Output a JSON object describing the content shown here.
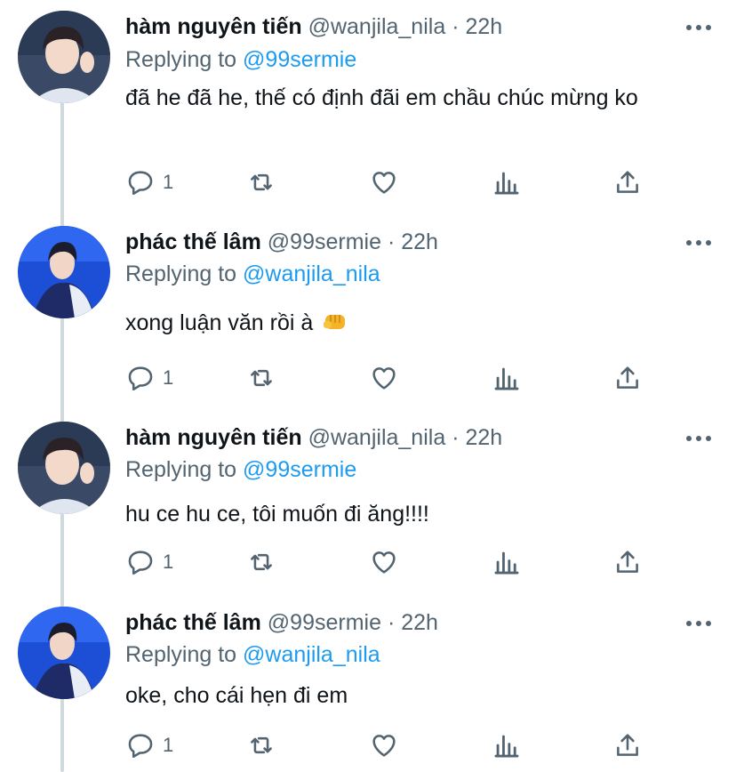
{
  "tweets": [
    {
      "name": "hàm nguyên tiến",
      "handle": "@wanjila_nila",
      "separator": "·",
      "time": "22h",
      "replying_label": "Replying to",
      "replying_to": "@99sermie",
      "text": "đã he đã he, thế có định đãi em chầu chúc mừng ko",
      "reply_count": "1",
      "avatar_icon": "avatar-boy-white-shirt"
    },
    {
      "name": "phác thế lâm",
      "handle": "@99sermie",
      "separator": "·",
      "time": "22h",
      "replying_label": "Replying to",
      "replying_to": "@wanjila_nila",
      "text": "xong luận văn rồi à",
      "emoji": "👊",
      "reply_count": "1",
      "avatar_icon": "avatar-boy-blue-jacket"
    },
    {
      "name": "hàm nguyên tiến",
      "handle": "@wanjila_nila",
      "separator": "·",
      "time": "22h",
      "replying_label": "Replying to",
      "replying_to": "@99sermie",
      "text": "hu ce hu ce, tôi muốn đi ăng!!!!",
      "reply_count": "1",
      "avatar_icon": "avatar-boy-white-shirt"
    },
    {
      "name": "phác thế lâm",
      "handle": "@99sermie",
      "separator": "·",
      "time": "22h",
      "replying_label": "Replying to",
      "replying_to": "@wanjila_nila",
      "text": "oke, cho cái hẹn đi em",
      "reply_count": "1",
      "avatar_icon": "avatar-boy-blue-jacket"
    }
  ],
  "colors": {
    "text": "#0f1419",
    "muted": "#536471",
    "link": "#1d9bf0",
    "thread_line": "#cfd9de"
  },
  "icons": [
    "reply-icon",
    "retweet-icon",
    "like-icon",
    "analytics-icon",
    "share-icon",
    "more-icon"
  ]
}
